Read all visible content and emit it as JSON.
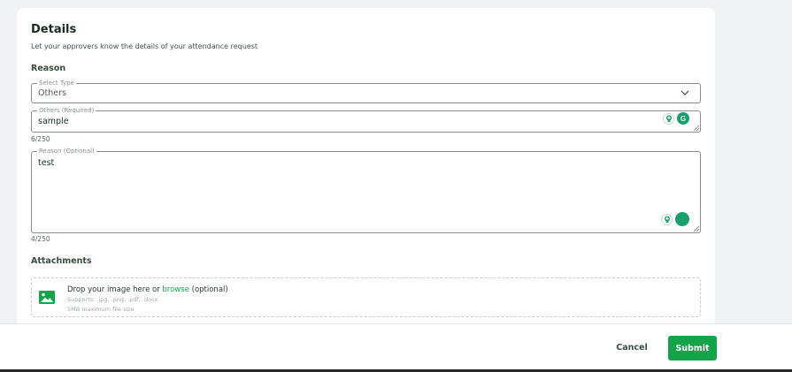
{
  "details": {
    "title": "Details",
    "subtitle": "Let your approvers know the details of your attendance request"
  },
  "reason_section": {
    "label": "Reason",
    "select_type": {
      "legend": "Select Type",
      "value": "Others"
    },
    "others": {
      "legend": "Others (Required)",
      "value": "sample",
      "counter": "6/250"
    },
    "reason": {
      "legend": "Reason (Optional)",
      "value": "test",
      "counter": "4/250"
    }
  },
  "attachments": {
    "label": "Attachments",
    "drop_text": "Drop your image here or",
    "browse_link": "browse",
    "optional_text": "(optional)",
    "supports": "Supports: .jpg, .png, .pdf, .docx",
    "max_size": "5MB maximum file size"
  },
  "footer": {
    "cancel_label": "Cancel",
    "submit_label": "Submit"
  },
  "colors": {
    "accent": "#15a34a",
    "extension": "#15a06c"
  },
  "icons": [
    "chevron-down-icon",
    "lightbulb-icon",
    "grammarly-icon",
    "image-icon",
    "resize-handle-icon"
  ]
}
